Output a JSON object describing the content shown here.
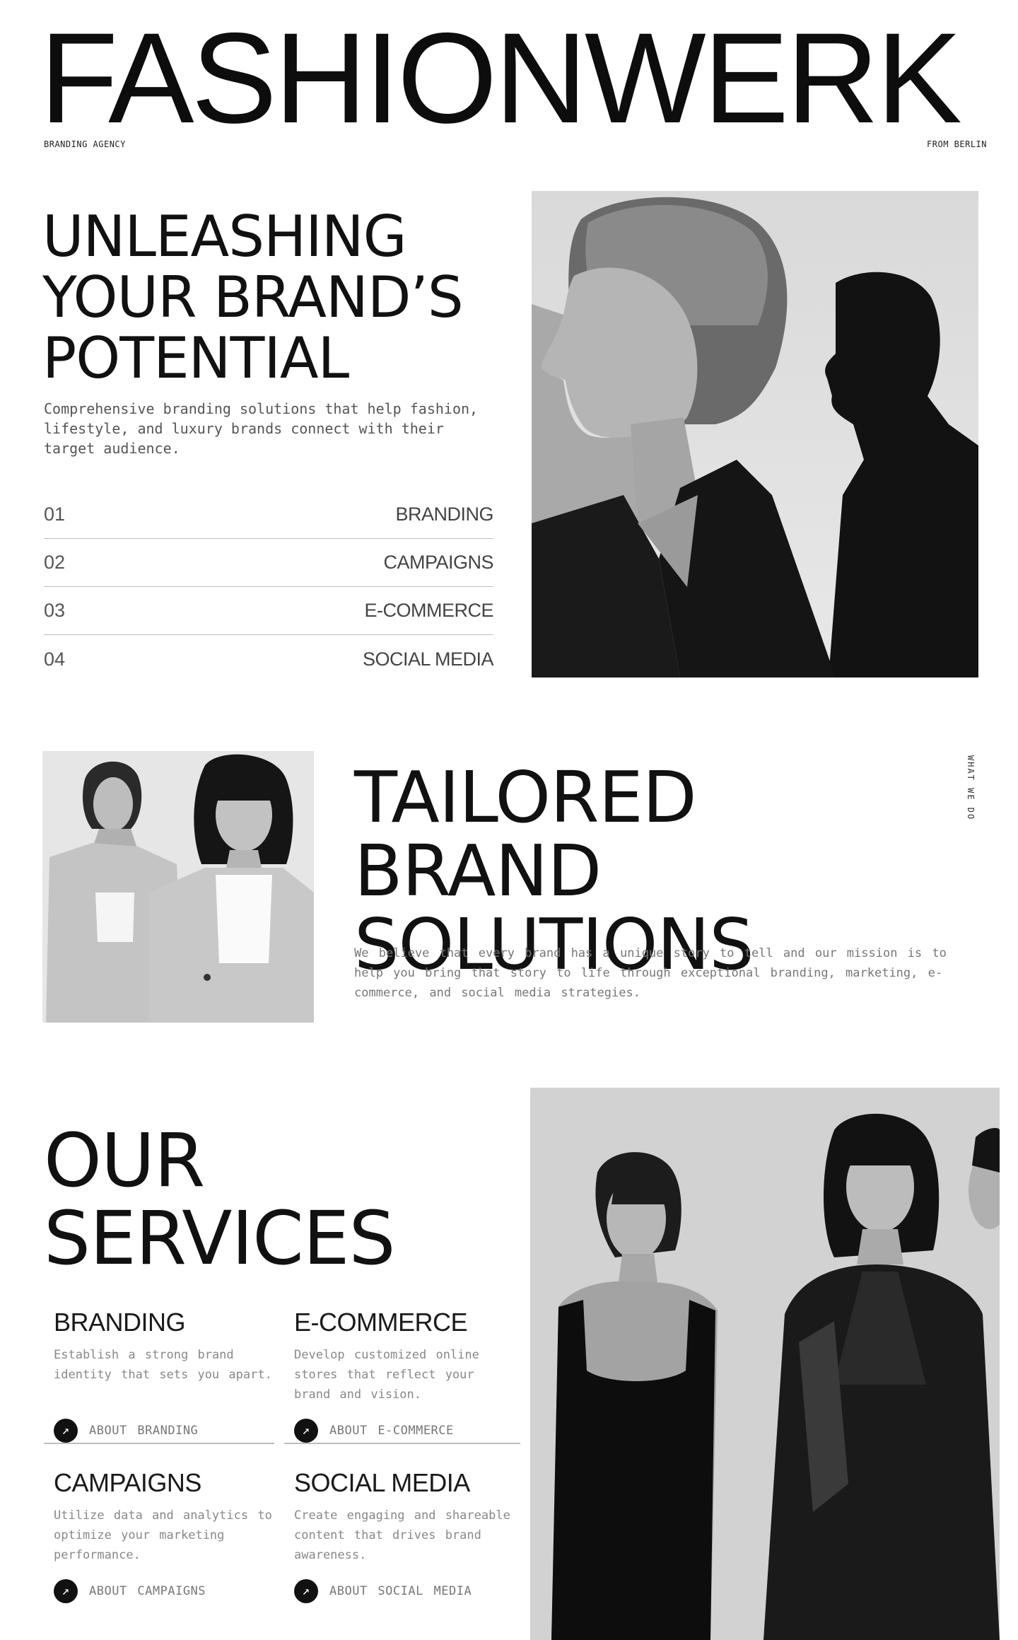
{
  "header": {
    "title": "FASHIONWERK",
    "left_label": "BRANDING AGENCY",
    "right_label": "FROM BERLIN"
  },
  "hero": {
    "heading": [
      "UNLEASHING",
      "YOUR BRAND’S",
      "POTENTIAL"
    ],
    "description": "Comprehensive branding solutions that help fashion, lifestyle, and luxury brands connect with their target audience.",
    "services": [
      {
        "num": "01",
        "name": "BRANDING"
      },
      {
        "num": "02",
        "name": "CAMPAIGNS"
      },
      {
        "num": "03",
        "name": "E-COMMERCE"
      },
      {
        "num": "04",
        "name": "SOCIAL MEDIA"
      }
    ]
  },
  "tailored": {
    "heading": [
      "TAILORED BRAND",
      "SOLUTIONS"
    ],
    "description": "We believe that every brand has a unique story to tell and our mission is to help you bring that story to life through exceptional branding, marketing, e-commerce, and social media strategies.",
    "side_label": "WHAT WE DO"
  },
  "services": {
    "heading": [
      "OUR",
      "SERVICES"
    ],
    "cards": [
      {
        "title": "BRANDING",
        "text": "Establish a strong brand identity that sets you apart.",
        "link": "ABOUT BRANDING"
      },
      {
        "title": "E-COMMERCE",
        "text": "Develop customized online stores that reflect your brand and vision.",
        "link": "ABOUT E-COMMERCE"
      },
      {
        "title": "CAMPAIGNS",
        "text": "Utilize data and analytics to optimize your marketing performance.",
        "link": "ABOUT CAMPAIGNS"
      },
      {
        "title": "SOCIAL MEDIA",
        "text": "Create engaging and shareable content that drives brand awareness.",
        "link": "ABOUT SOCIAL MEDIA"
      }
    ],
    "arrow_icon": "↗"
  },
  "colors": {
    "text": "#111111",
    "muted": "#777777",
    "divider": "#bdbdbd",
    "accent": "#111111"
  }
}
